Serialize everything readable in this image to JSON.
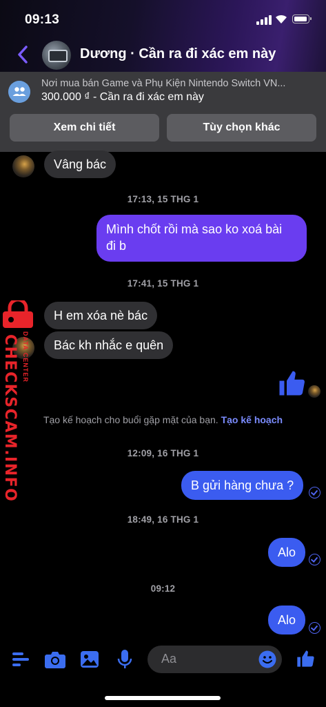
{
  "status_bar": {
    "time": "09:13"
  },
  "header": {
    "title": "Dương · Cần ra đi xác em này"
  },
  "listing": {
    "group": "Nơi mua bán Game và Phụ Kiện Nintendo Switch VN...",
    "price_line": "300.000 ₫ - Cần ra đi xác em này",
    "details_button": "Xem chi tiết",
    "options_button": "Tùy chọn khác"
  },
  "messages": {
    "m1": "Vâng bác",
    "ts1": "17:13, 15 THG 1",
    "m2_line1": "Mình chốt rồi mà sao ko xoá bài",
    "m2_line2": "đi b",
    "ts2": "17:41, 15 THG 1",
    "m3": "H em xóa nè bác",
    "m4": "Bác kh nhắc e quên",
    "plan_text": "Tạo kế hoạch cho buổi gặp mặt của bạn.",
    "plan_link": "Tạo kế hoạch",
    "ts3": "12:09, 16 THG 1",
    "m5": "B gửi hàng chưa ?",
    "ts4": "18:49, 16 THG 1",
    "m6": "Alo",
    "ts5": "09:12",
    "m7": "Alo"
  },
  "watermark": {
    "main": "CHECKSCAM.INFO",
    "sub": "DATA CENTER"
  },
  "composer": {
    "placeholder": "Aa"
  },
  "colors": {
    "sent_purple": "#6a3df0",
    "sent_blue": "#3b5cf0",
    "accent": "#4f64f0",
    "received": "#303033"
  },
  "icons": [
    "back-icon",
    "group-icon",
    "menu-icon",
    "camera-icon",
    "image-icon",
    "microphone-icon",
    "emoji-icon",
    "like-icon"
  ]
}
